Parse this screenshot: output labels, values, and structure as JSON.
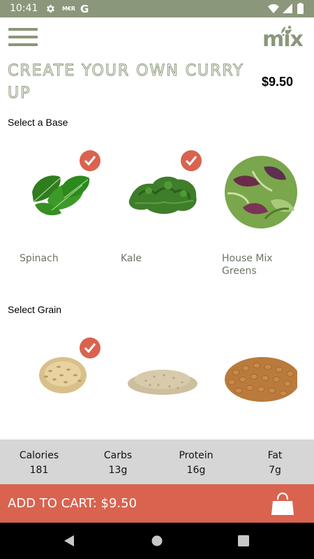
{
  "status_bar": {
    "time": "10:41",
    "icons": [
      "gear-icon",
      "mbr-icon",
      "google-icon",
      "wifi-icon",
      "signal-icon",
      "battery-icon"
    ],
    "mbr_text": "M€R",
    "google_text": "G"
  },
  "header": {
    "menu_icon": "hamburger-menu-icon",
    "logo_text": "mix",
    "title": "CREATE YOUR OWN CURRY UP",
    "price": "$9.50"
  },
  "base_section": {
    "label": "Select a Base",
    "items": [
      {
        "label": "Spinach",
        "selected": true,
        "image": "spinach-image"
      },
      {
        "label": "Kale",
        "selected": true,
        "image": "kale-image"
      },
      {
        "label": "House Mix Greens",
        "selected": false,
        "image": "house-mix-greens-image"
      }
    ]
  },
  "grain_section": {
    "label": "Select Grain",
    "items": [
      {
        "label": "",
        "selected": true,
        "image": "brown-rice-image"
      },
      {
        "label": "",
        "selected": false,
        "image": "quinoa-image"
      },
      {
        "label": "",
        "selected": false,
        "image": "farro-image"
      }
    ]
  },
  "nutrition": {
    "calories": {
      "label": "Calories",
      "value": "181"
    },
    "carbs": {
      "label": "Carbs",
      "value": "13g"
    },
    "protein": {
      "label": "Protein",
      "value": "16g"
    },
    "fat": {
      "label": "Fat",
      "value": "7g"
    }
  },
  "cart": {
    "label": "ADD TO CART: $9.50",
    "icon": "shopping-bag-icon"
  },
  "nav": {
    "back_icon": "back-triangle-icon",
    "home_icon": "home-circle-icon",
    "recents_icon": "recents-square-icon"
  },
  "colors": {
    "accent_green": "#8a977a",
    "accent_red": "#d9634f",
    "nutrition_bg": "#d6d6d6"
  }
}
